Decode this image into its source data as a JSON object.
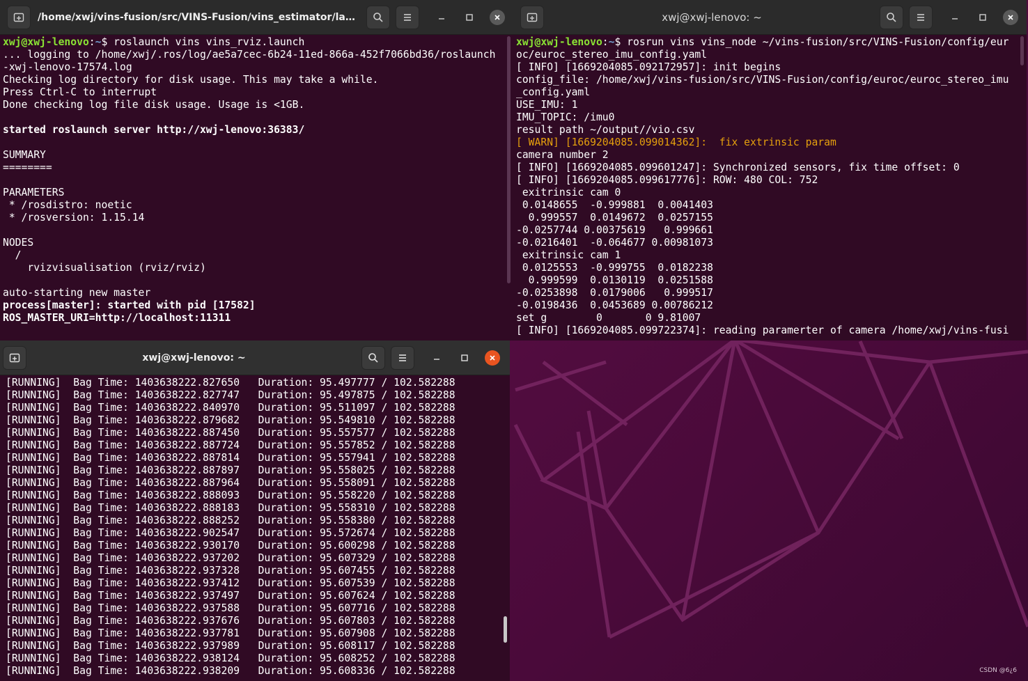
{
  "colors": {
    "terminal_bg": "#300a24",
    "titlebar": "#2b2b2b",
    "prompt_user": "#8ae234",
    "prompt_path": "#729fcf",
    "warn": "#e5a00d",
    "close_active": "#e95420"
  },
  "windows": {
    "top_left": {
      "title": "/home/xwj/vins-fusion/src/VINS-Fusion/vins_estimator/laun...",
      "lines": [
        {
          "type": "prompt",
          "user": "xwj@xwj-lenovo",
          "path": "~",
          "cmd": "$ roslaunch vins vins_rviz.launch"
        },
        {
          "type": "text",
          "text": "... logging to /home/xwj/.ros/log/ae5a7cec-6b24-11ed-866a-452f7066bd36/roslaunch"
        },
        {
          "type": "text",
          "text": "-xwj-lenovo-17574.log"
        },
        {
          "type": "text",
          "text": "Checking log directory for disk usage. This may take a while."
        },
        {
          "type": "text",
          "text": "Press Ctrl-C to interrupt"
        },
        {
          "type": "text",
          "text": "Done checking log file disk usage. Usage is <1GB."
        },
        {
          "type": "text",
          "text": ""
        },
        {
          "type": "bold",
          "text": "started roslaunch server http://xwj-lenovo:36383/"
        },
        {
          "type": "text",
          "text": ""
        },
        {
          "type": "text",
          "text": "SUMMARY"
        },
        {
          "type": "text",
          "text": "========"
        },
        {
          "type": "text",
          "text": ""
        },
        {
          "type": "text",
          "text": "PARAMETERS"
        },
        {
          "type": "text",
          "text": " * /rosdistro: noetic"
        },
        {
          "type": "text",
          "text": " * /rosversion: 1.15.14"
        },
        {
          "type": "text",
          "text": ""
        },
        {
          "type": "text",
          "text": "NODES"
        },
        {
          "type": "text",
          "text": "  /"
        },
        {
          "type": "text",
          "text": "    rvizvisualisation (rviz/rviz)"
        },
        {
          "type": "text",
          "text": ""
        },
        {
          "type": "text",
          "text": "auto-starting new master"
        },
        {
          "type": "bold",
          "text": "process[master]: started with pid [17582]"
        },
        {
          "type": "bold",
          "text": "ROS_MASTER_URI=http://localhost:11311"
        }
      ]
    },
    "top_right": {
      "title": "xwj@xwj-lenovo: ~",
      "lines": [
        {
          "type": "prompt",
          "user": "xwj@xwj-lenovo",
          "path": "~",
          "cmd": "$ rosrun vins vins_node ~/vins-fusion/src/VINS-Fusion/config/eur"
        },
        {
          "type": "text",
          "text": "oc/euroc_stereo_imu_config.yaml"
        },
        {
          "type": "text",
          "text": "[ INFO] [1669204085.092172957]: init begins"
        },
        {
          "type": "text",
          "text": "config_file: /home/xwj/vins-fusion/src/VINS-Fusion/config/euroc/euroc_stereo_imu"
        },
        {
          "type": "text",
          "text": "_config.yaml"
        },
        {
          "type": "text",
          "text": "USE_IMU: 1"
        },
        {
          "type": "text",
          "text": "IMU_TOPIC: /imu0"
        },
        {
          "type": "text",
          "text": "result path ~/output//vio.csv"
        },
        {
          "type": "warn",
          "text": "[ WARN] [1669204085.099014362]:  fix extrinsic param"
        },
        {
          "type": "text",
          "text": "camera number 2"
        },
        {
          "type": "text",
          "text": "[ INFO] [1669204085.099601247]: Synchronized sensors, fix time offset: 0"
        },
        {
          "type": "text",
          "text": "[ INFO] [1669204085.099617776]: ROW: 480 COL: 752"
        },
        {
          "type": "text",
          "text": " exitrinsic cam 0"
        },
        {
          "type": "text",
          "text": " 0.0148655  -0.999881  0.0041403"
        },
        {
          "type": "text",
          "text": "  0.999557  0.0149672  0.0257155"
        },
        {
          "type": "text",
          "text": "-0.0257744 0.00375619   0.999661"
        },
        {
          "type": "text",
          "text": "-0.0216401  -0.064677 0.00981073"
        },
        {
          "type": "text",
          "text": " exitrinsic cam 1"
        },
        {
          "type": "text",
          "text": " 0.0125553  -0.999755  0.0182238"
        },
        {
          "type": "text",
          "text": "  0.999599  0.0130119  0.0251588"
        },
        {
          "type": "text",
          "text": "-0.0253898  0.0179006   0.999517"
        },
        {
          "type": "text",
          "text": "-0.0198436  0.0453689 0.00786212"
        },
        {
          "type": "text",
          "text": "set g        0       0 9.81007"
        },
        {
          "type": "text",
          "text": "[ INFO] [1669204085.099722374]: reading paramerter of camera /home/xwj/vins-fusi"
        }
      ]
    },
    "bottom": {
      "title": "xwj@xwj-lenovo: ~",
      "rows": [
        {
          "bag_time": "1403638222.827650",
          "duration": "95.497777",
          "total": "102.582288"
        },
        {
          "bag_time": "1403638222.827747",
          "duration": "95.497875",
          "total": "102.582288"
        },
        {
          "bag_time": "1403638222.840970",
          "duration": "95.511097",
          "total": "102.582288"
        },
        {
          "bag_time": "1403638222.879682",
          "duration": "95.549810",
          "total": "102.582288"
        },
        {
          "bag_time": "1403638222.887450",
          "duration": "95.557577",
          "total": "102.582288"
        },
        {
          "bag_time": "1403638222.887724",
          "duration": "95.557852",
          "total": "102.582288"
        },
        {
          "bag_time": "1403638222.887814",
          "duration": "95.557941",
          "total": "102.582288"
        },
        {
          "bag_time": "1403638222.887897",
          "duration": "95.558025",
          "total": "102.582288"
        },
        {
          "bag_time": "1403638222.887964",
          "duration": "95.558091",
          "total": "102.582288"
        },
        {
          "bag_time": "1403638222.888093",
          "duration": "95.558220",
          "total": "102.582288"
        },
        {
          "bag_time": "1403638222.888183",
          "duration": "95.558310",
          "total": "102.582288"
        },
        {
          "bag_time": "1403638222.888252",
          "duration": "95.558380",
          "total": "102.582288"
        },
        {
          "bag_time": "1403638222.902547",
          "duration": "95.572674",
          "total": "102.582288"
        },
        {
          "bag_time": "1403638222.930170",
          "duration": "95.600298",
          "total": "102.582288"
        },
        {
          "bag_time": "1403638222.937202",
          "duration": "95.607329",
          "total": "102.582288"
        },
        {
          "bag_time": "1403638222.937328",
          "duration": "95.607455",
          "total": "102.582288"
        },
        {
          "bag_time": "1403638222.937412",
          "duration": "95.607539",
          "total": "102.582288"
        },
        {
          "bag_time": "1403638222.937497",
          "duration": "95.607624",
          "total": "102.582288"
        },
        {
          "bag_time": "1403638222.937588",
          "duration": "95.607716",
          "total": "102.582288"
        },
        {
          "bag_time": "1403638222.937676",
          "duration": "95.607803",
          "total": "102.582288"
        },
        {
          "bag_time": "1403638222.937781",
          "duration": "95.607908",
          "total": "102.582288"
        },
        {
          "bag_time": "1403638222.937989",
          "duration": "95.608117",
          "total": "102.582288"
        },
        {
          "bag_time": "1403638222.938124",
          "duration": "95.608252",
          "total": "102.582288"
        },
        {
          "bag_time": "1403638222.938209",
          "duration": "95.608336",
          "total": "102.582288"
        }
      ],
      "status_label": "[RUNNING]",
      "bag_time_label": "Bag Time:",
      "duration_label": "Duration:"
    }
  },
  "desktop": {
    "watermark": "CSDN @6¿6"
  }
}
